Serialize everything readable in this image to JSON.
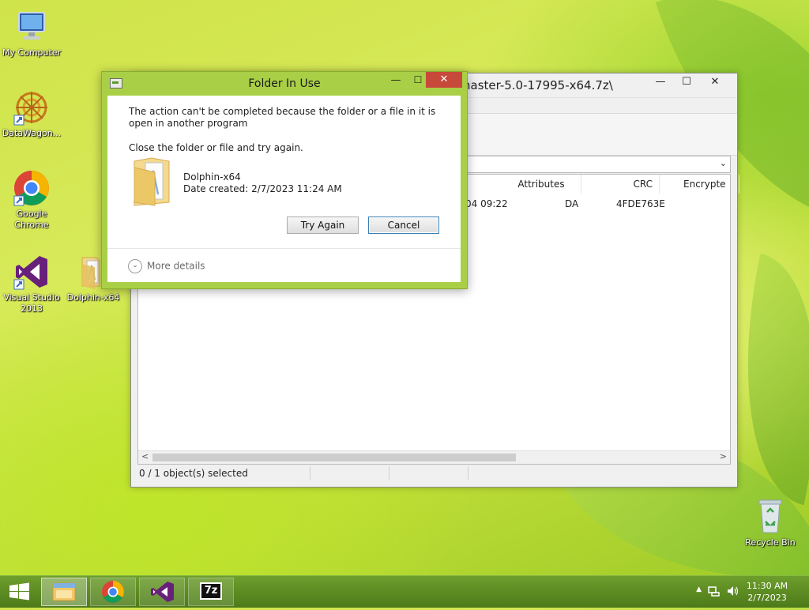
{
  "desktop": {
    "icons": [
      {
        "label": "My Computer"
      },
      {
        "label": "DataWagon..."
      },
      {
        "label": "Google Chrome"
      },
      {
        "label": "Visual Studio 2013"
      },
      {
        "label": "Dolphin-x64"
      },
      {
        "label": "Recycle Bin"
      }
    ]
  },
  "main_window": {
    "title": "naster-5.0-17995-x64.7z\\",
    "minimize": "—",
    "maximize": "☐",
    "close": "✕",
    "columns": [
      "Attributes",
      "CRC",
      "Encrypte"
    ],
    "row": {
      "modified": "04 09:22",
      "attributes": "DA",
      "crc": "4FDE763E"
    },
    "status": "0 / 1 object(s) selected"
  },
  "dialog": {
    "title": "Folder In Use",
    "minimize": "—",
    "maximize": "☐",
    "close": "✕",
    "message": "The action can't be completed because the folder or a file in it is open in another program",
    "hint": "Close the folder or file and try again.",
    "item_name": "Dolphin-x64",
    "item_date": "Date created: 2/7/2023 11:24 AM",
    "try_again": "Try Again",
    "cancel": "Cancel",
    "more_details": "More details"
  },
  "taskbar": {
    "time": "11:30 AM",
    "date": "2/7/2023",
    "sevenzip_label": "7z"
  },
  "colors": {
    "dialog_frame": "#a9cf46",
    "close_button": "#c7493a",
    "taskbar": "#5a8a22"
  }
}
